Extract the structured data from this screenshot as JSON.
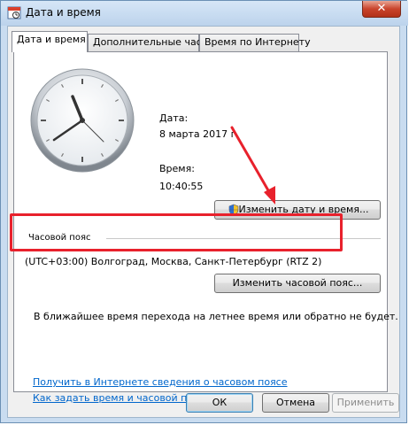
{
  "window": {
    "title": "Дата и время",
    "close_glyph": "✕"
  },
  "tabs": [
    {
      "label": "Дата и время"
    },
    {
      "label": "Дополнительные часы"
    },
    {
      "label": "Время по Интернету"
    }
  ],
  "date": {
    "label": "Дата:",
    "value": "8 марта 2017 г."
  },
  "time": {
    "label": "Время:",
    "value": "10:40:55"
  },
  "buttons": {
    "change_datetime": "Изменить дату и время...",
    "change_timezone": "Изменить часовой пояс...",
    "ok": "ОК",
    "cancel": "Отмена",
    "apply": "Применить"
  },
  "timezone": {
    "label": "Часовой пояс",
    "value": "(UTC+03:00) Волгоград, Москва, Санкт-Петербург (RTZ 2)"
  },
  "dst_note": "В ближайшее время перехода на летнее время или обратно не будет.",
  "links": {
    "internet_info": "Получить в Интернете сведения о часовом поясе",
    "how_to_set": "Как задать время и часовой пояс?"
  },
  "colors": {
    "highlight": "#e8212c",
    "link": "#0066cc"
  }
}
